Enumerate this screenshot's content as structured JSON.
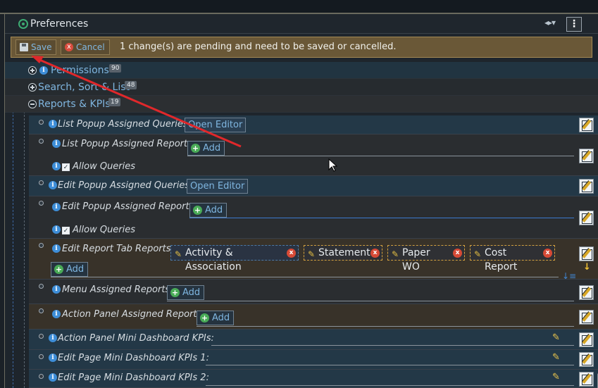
{
  "header": {
    "title": "Preferences",
    "split_icon": "split-view-icon",
    "menu_icon": "kebab-menu-icon"
  },
  "pending": {
    "save_label": "Save",
    "cancel_label": "Cancel",
    "message": "1 change(s) are pending and need to be saved or cancelled."
  },
  "sections": [
    {
      "label": "Permissions",
      "count": "90",
      "expanded": false
    },
    {
      "label": "Search, Sort & List",
      "count": "48",
      "expanded": false
    },
    {
      "label": "Reports & KPIs",
      "count": "19",
      "expanded": true
    }
  ],
  "props": {
    "list_popup_queries": {
      "label": "List Popup Assigned Queries:",
      "button": "Open Editor"
    },
    "list_popup_reports": {
      "label": "List Popup Assigned Reports:",
      "button": "Add",
      "checkbox": "Allow Queries",
      "checked": true
    },
    "edit_popup_queries": {
      "label": "Edit Popup Assigned Queries:",
      "button": "Open Editor"
    },
    "edit_popup_reports": {
      "label": "Edit Popup Assigned Reports:",
      "button": "Add",
      "checkbox": "Allow Queries",
      "checked": true
    },
    "edit_report_tab": {
      "label": "Edit Report Tab Reports:",
      "chips": [
        "Activity & Association",
        "Statement",
        "Paper WO",
        "Cost Report"
      ],
      "button": "Add"
    },
    "menu_reports": {
      "label": "Menu Assigned Reports:",
      "button": "Add"
    },
    "action_panel_reports": {
      "label": "Action Panel Assigned Reports:",
      "button": "Add"
    },
    "action_panel_kpis": {
      "label": "Action Panel Mini Dashboard KPIs:"
    },
    "edit_page_kpis_1": {
      "label": "Edit Page Mini Dashboard KPIs 1:"
    },
    "edit_page_kpis_2": {
      "label": "Edit Page Mini Dashboard KPIs 2:"
    }
  },
  "icons": {
    "info": "i",
    "plus": "+",
    "close": "x",
    "pencil": "✎",
    "check": "✓"
  },
  "colors": {
    "accent": "#7fb5df",
    "pending_bg": "#6a5837",
    "add_green": "#49ab57",
    "remove_red": "#d74a36"
  }
}
